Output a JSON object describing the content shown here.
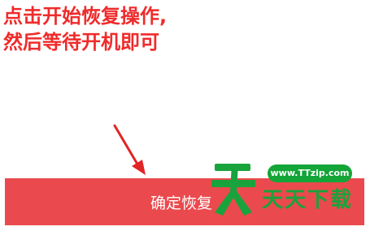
{
  "instruction": {
    "line1": "点击开始恢复操作,",
    "line2": "然后等待开机即可"
  },
  "confirm_button": {
    "label": "确定恢复"
  },
  "watermark": {
    "url": "www.TTzip.com",
    "text": "天天下载",
    "logo_text": "天"
  },
  "colors": {
    "instruction_text": "#ef2b2b",
    "button_bg": "#ea4a4d",
    "watermark_green": "#13a537"
  },
  "icons": {
    "arrow": "arrow-down-right-icon"
  }
}
